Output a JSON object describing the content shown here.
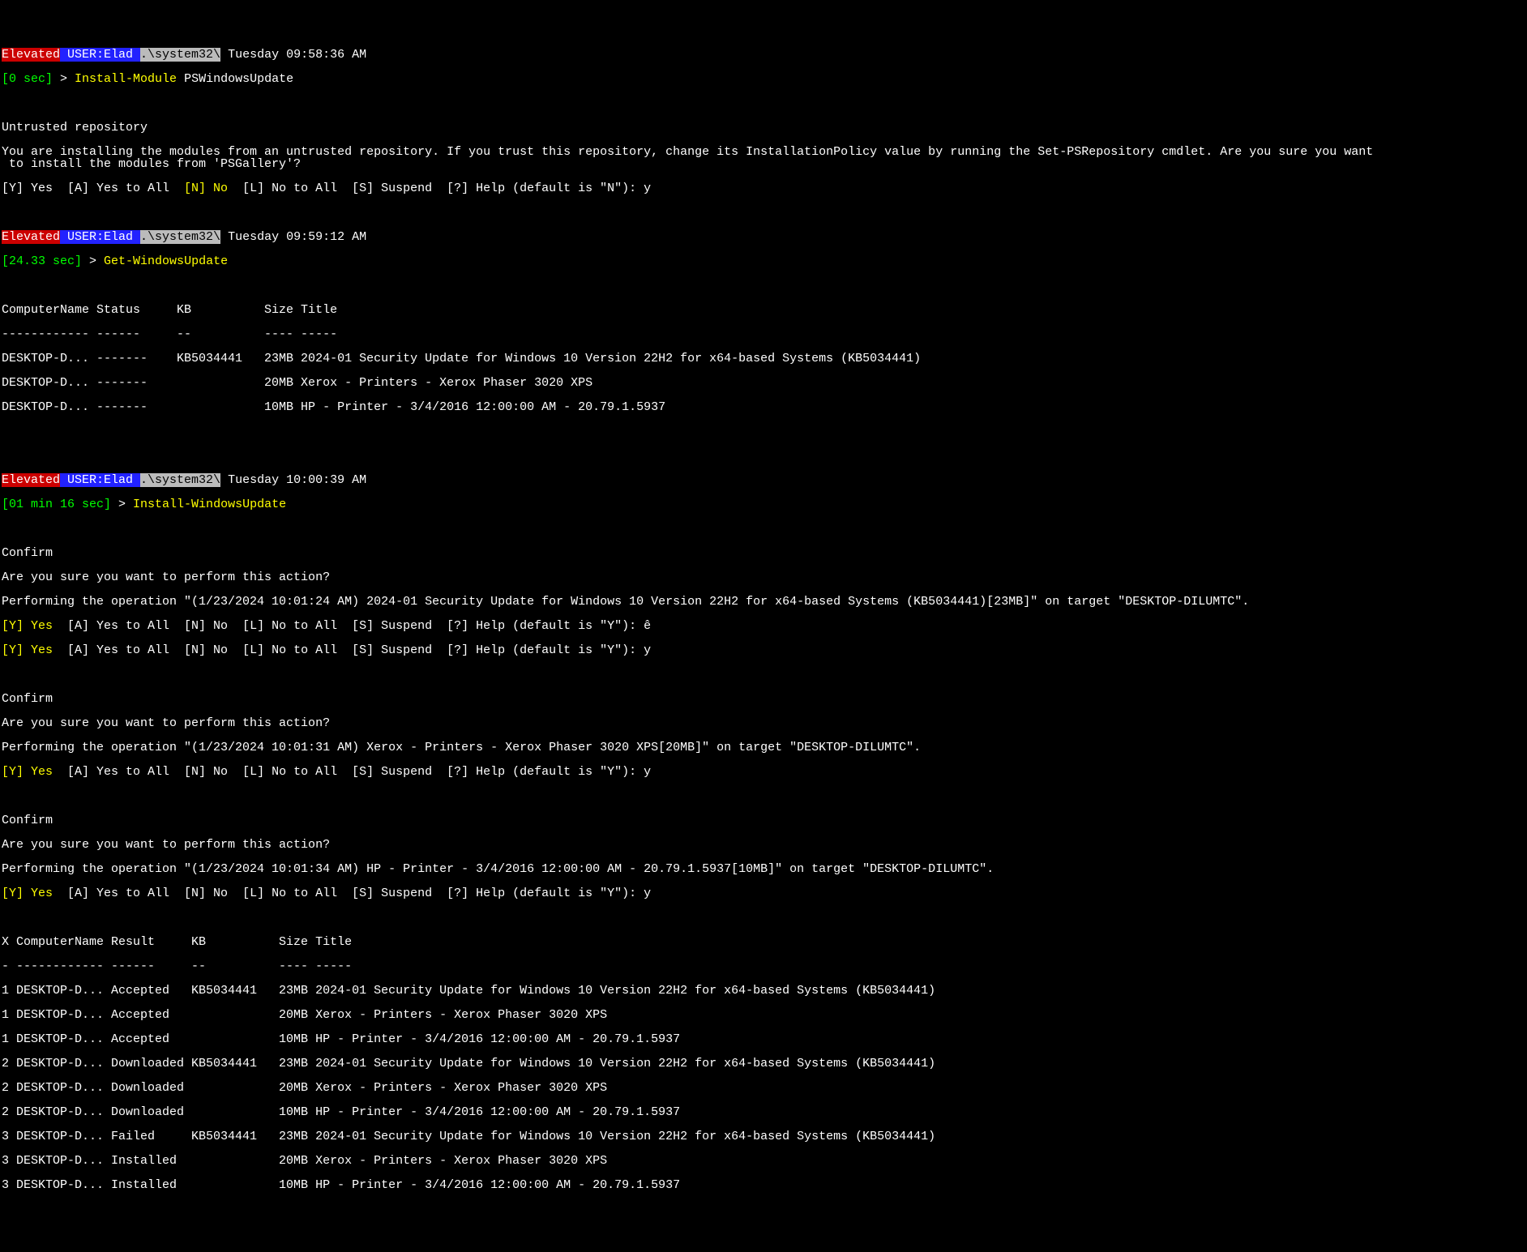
{
  "prompt1": {
    "elevated": "Elevated",
    "user": " USER:Elad ",
    "path": ".\\system32\\",
    "time": " Tuesday 09:58:36 AM",
    "dur": "[0 sec]",
    "arrow": " > ",
    "cmd": "Install-Module",
    "args": " PSWindowsUpdate"
  },
  "untrusted": {
    "title": "Untrusted repository",
    "body": "You are installing the modules from an untrusted repository. If you trust this repository, change its InstallationPolicy value by running the Set-PSRepository cmdlet. Are you sure you want\n to install the modules from 'PSGallery'?",
    "opt_y": "[Y] Yes  ",
    "opt_a": "[A] Yes to All  ",
    "opt_n": "[N] No",
    "opt_l": "  [L] No to All  ",
    "opt_s": "[S] Suspend  ",
    "opt_h": "[?] Help (default is \"N\"): ",
    "ans": "y"
  },
  "prompt2": {
    "elevated": "Elevated",
    "user": " USER:Elad ",
    "path": ".\\system32\\",
    "time": " Tuesday 09:59:12 AM",
    "dur": "[24.33 sec]",
    "arrow": " > ",
    "cmd": "Get-WindowsUpdate"
  },
  "table1": {
    "header": "ComputerName Status     KB          Size Title",
    "rule": "------------ ------     --          ---- -----",
    "rows": [
      "DESKTOP-D... -------    KB5034441   23MB 2024-01 Security Update for Windows 10 Version 22H2 for x64-based Systems (KB5034441)",
      "DESKTOP-D... -------                20MB Xerox - Printers - Xerox Phaser 3020 XPS",
      "DESKTOP-D... -------                10MB HP - Printer - 3/4/2016 12:00:00 AM - 20.79.1.5937"
    ]
  },
  "prompt3": {
    "elevated": "Elevated",
    "user": " USER:Elad ",
    "path": ".\\system32\\",
    "time": " Tuesday 10:00:39 AM",
    "dur": "[01 min 16 sec]",
    "arrow": " > ",
    "cmd": "Install-WindowsUpdate"
  },
  "confirm1": {
    "title": "Confirm",
    "q": "Are you sure you want to perform this action?",
    "op": "Performing the operation \"(1/23/2024 10:01:24 AM) 2024-01 Security Update for Windows 10 Version 22H2 for x64-based Systems (KB5034441)[23MB]\" on target \"DESKTOP-DILUMTC\".",
    "opt_y": "[Y] Yes",
    "opt_a": "  [A] Yes to All  ",
    "opt_n": "[N] No  ",
    "opt_l": "[L] No to All  ",
    "opt_s": "[S] Suspend  ",
    "opt_h1": "[?] Help (default is \"Y\"): ",
    "ans1": "ê",
    "opt_h2": "[?] Help (default is \"Y\"): ",
    "ans2": "y"
  },
  "confirm2": {
    "title": "Confirm",
    "q": "Are you sure you want to perform this action?",
    "op": "Performing the operation \"(1/23/2024 10:01:31 AM) Xerox - Printers - Xerox Phaser 3020 XPS[20MB]\" on target \"DESKTOP-DILUMTC\".",
    "opt_y": "[Y] Yes",
    "opt_a": "  [A] Yes to All  ",
    "opt_n": "[N] No  ",
    "opt_l": "[L] No to All  ",
    "opt_s": "[S] Suspend  ",
    "opt_h": "[?] Help (default is \"Y\"): ",
    "ans": "y"
  },
  "confirm3": {
    "title": "Confirm",
    "q": "Are you sure you want to perform this action?",
    "op": "Performing the operation \"(1/23/2024 10:01:34 AM) HP - Printer - 3/4/2016 12:00:00 AM - 20.79.1.5937[10MB]\" on target \"DESKTOP-DILUMTC\".",
    "opt_y": "[Y] Yes",
    "opt_a": "  [A] Yes to All  ",
    "opt_n": "[N] No  ",
    "opt_l": "[L] No to All  ",
    "opt_s": "[S] Suspend  ",
    "opt_h": "[?] Help (default is \"Y\"): ",
    "ans": "y"
  },
  "table2": {
    "header": "X ComputerName Result     KB          Size Title",
    "rule": "- ------------ ------     --          ---- -----",
    "rows": [
      "1 DESKTOP-D... Accepted   KB5034441   23MB 2024-01 Security Update for Windows 10 Version 22H2 for x64-based Systems (KB5034441)",
      "1 DESKTOP-D... Accepted               20MB Xerox - Printers - Xerox Phaser 3020 XPS",
      "1 DESKTOP-D... Accepted               10MB HP - Printer - 3/4/2016 12:00:00 AM - 20.79.1.5937",
      "2 DESKTOP-D... Downloaded KB5034441   23MB 2024-01 Security Update for Windows 10 Version 22H2 for x64-based Systems (KB5034441)",
      "2 DESKTOP-D... Downloaded             20MB Xerox - Printers - Xerox Phaser 3020 XPS",
      "2 DESKTOP-D... Downloaded             10MB HP - Printer - 3/4/2016 12:00:00 AM - 20.79.1.5937",
      "3 DESKTOP-D... Failed     KB5034441   23MB 2024-01 Security Update for Windows 10 Version 22H2 for x64-based Systems (KB5034441)",
      "3 DESKTOP-D... Installed              20MB Xerox - Printers - Xerox Phaser 3020 XPS",
      "3 DESKTOP-D... Installed              10MB HP - Printer - 3/4/2016 12:00:00 AM - 20.79.1.5937"
    ]
  }
}
